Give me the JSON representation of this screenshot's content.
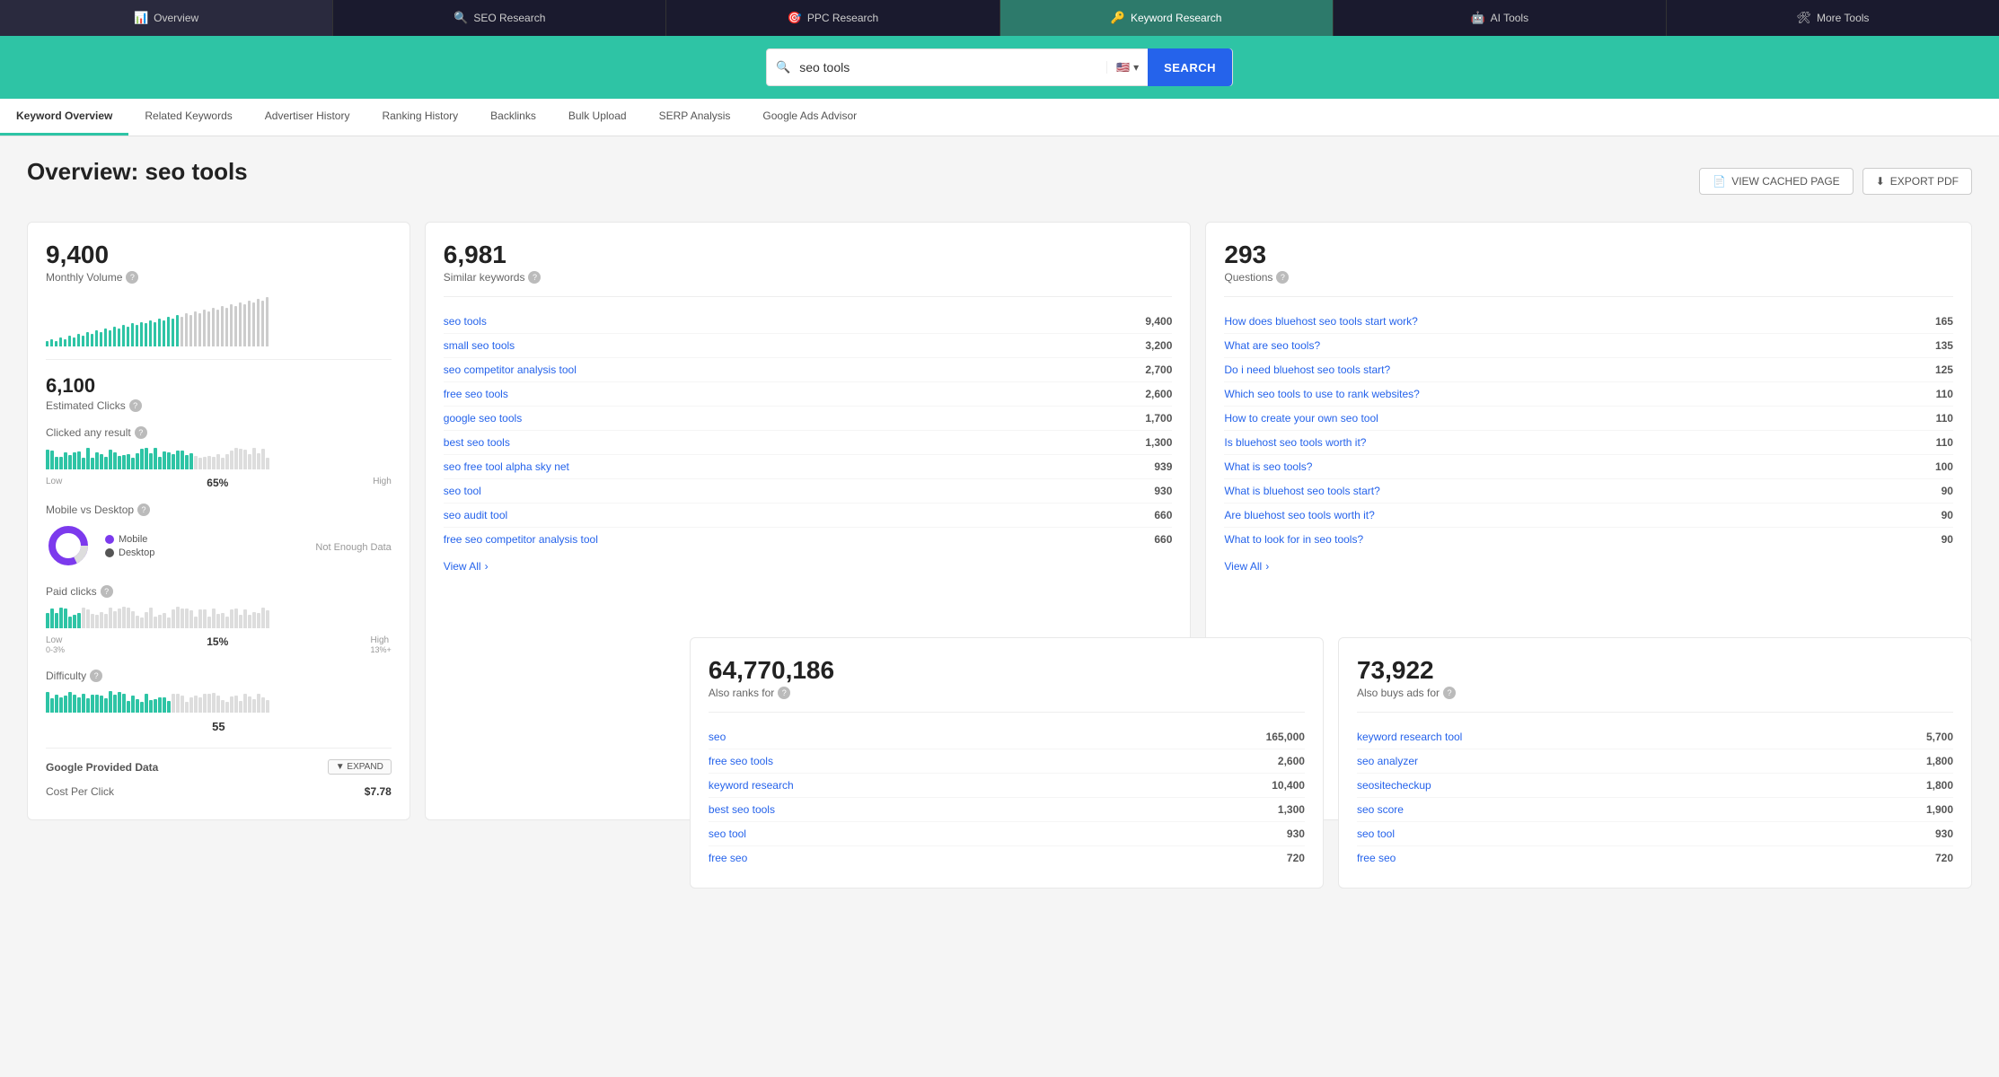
{
  "topNav": {
    "items": [
      {
        "id": "overview",
        "label": "Overview",
        "icon": "📊",
        "active": false
      },
      {
        "id": "seo-research",
        "label": "SEO Research",
        "icon": "🔍",
        "active": false
      },
      {
        "id": "ppc-research",
        "label": "PPC Research",
        "icon": "🎯",
        "active": false
      },
      {
        "id": "keyword-research",
        "label": "Keyword Research",
        "icon": "🔑",
        "active": true
      },
      {
        "id": "ai-tools",
        "label": "AI Tools",
        "icon": "🤖",
        "active": false
      },
      {
        "id": "more-tools",
        "label": "More Tools",
        "icon": "🛠",
        "active": false
      }
    ]
  },
  "search": {
    "query": "seo tools",
    "placeholder": "seo tools",
    "button_label": "SEARCH",
    "flag": "🇺🇸"
  },
  "subNav": {
    "items": [
      {
        "id": "keyword-overview",
        "label": "Keyword Overview",
        "active": true
      },
      {
        "id": "related-keywords",
        "label": "Related Keywords",
        "active": false
      },
      {
        "id": "advertiser-history",
        "label": "Advertiser History",
        "active": false
      },
      {
        "id": "ranking-history",
        "label": "Ranking History",
        "active": false
      },
      {
        "id": "backlinks",
        "label": "Backlinks",
        "active": false
      },
      {
        "id": "bulk-upload",
        "label": "Bulk Upload",
        "active": false
      },
      {
        "id": "serp-analysis",
        "label": "SERP Analysis",
        "active": false
      },
      {
        "id": "google-ads-advisor",
        "label": "Google Ads Advisor",
        "active": false
      }
    ]
  },
  "pageTitle": "Overview: seo tools",
  "actions": {
    "view_cached": "VIEW CACHED PAGE",
    "export_pdf": "EXPORT PDF"
  },
  "leftCard": {
    "monthly_volume": "9,400",
    "monthly_volume_label": "Monthly Volume",
    "estimated_clicks": "6,100",
    "estimated_clicks_label": "Estimated Clicks",
    "clicked_label": "Clicked any result",
    "clicked_pct": "65%",
    "clicked_low": "Low",
    "clicked_high": "High",
    "mobile_vs_desktop_label": "Mobile vs Desktop",
    "mobile_label": "Mobile",
    "desktop_label": "Desktop",
    "not_enough_data": "Not Enough Data",
    "paid_clicks_label": "Paid clicks",
    "paid_pct": "15%",
    "paid_low": "Low",
    "paid_low_range": "0-3%",
    "paid_high": "High",
    "paid_high_range": "13%+",
    "difficulty_label": "Difficulty",
    "difficulty_val": "55",
    "google_provided_label": "Google Provided Data",
    "expand_label": "▼ EXPAND",
    "cost_per_click_label": "Cost Per Click",
    "cost_per_click_val": "$7.78"
  },
  "similarKeywords": {
    "number": "6,981",
    "label": "Similar keywords",
    "rows": [
      {
        "keyword": "seo tools",
        "volume": "9,400"
      },
      {
        "keyword": "small seo tools",
        "volume": "3,200"
      },
      {
        "keyword": "seo competitor analysis tool",
        "volume": "2,700"
      },
      {
        "keyword": "free seo tools",
        "volume": "2,600"
      },
      {
        "keyword": "google seo tools",
        "volume": "1,700"
      },
      {
        "keyword": "best seo tools",
        "volume": "1,300"
      },
      {
        "keyword": "seo free tool alpha sky net",
        "volume": "939"
      },
      {
        "keyword": "seo tool",
        "volume": "930"
      },
      {
        "keyword": "seo audit tool",
        "volume": "660"
      },
      {
        "keyword": "free seo competitor analysis tool",
        "volume": "660"
      }
    ],
    "view_all": "View All"
  },
  "questions": {
    "number": "293",
    "label": "Questions",
    "rows": [
      {
        "question": "How does bluehost seo tools start work?",
        "volume": "165"
      },
      {
        "question": "What are seo tools?",
        "volume": "135"
      },
      {
        "question": "Do i need bluehost seo tools start?",
        "volume": "125"
      },
      {
        "question": "Which seo tools to use to rank websites?",
        "volume": "110"
      },
      {
        "question": "How to create your own seo tool",
        "volume": "110"
      },
      {
        "question": "Is bluehost seo tools worth it?",
        "volume": "110"
      },
      {
        "question": "What is seo tools?",
        "volume": "100"
      },
      {
        "question": "What is bluehost seo tools start?",
        "volume": "90"
      },
      {
        "question": "Are bluehost seo tools worth it?",
        "volume": "90"
      },
      {
        "question": "What to look for in seo tools?",
        "volume": "90"
      }
    ],
    "view_all": "View All"
  },
  "alsoRanksFor": {
    "number": "64,770,186",
    "label": "Also ranks for",
    "rows": [
      {
        "keyword": "seo",
        "volume": "165,000"
      },
      {
        "keyword": "free seo tools",
        "volume": "2,600"
      },
      {
        "keyword": "keyword research",
        "volume": "10,400"
      },
      {
        "keyword": "best seo tools",
        "volume": "1,300"
      },
      {
        "keyword": "seo tool",
        "volume": "930"
      },
      {
        "keyword": "free seo",
        "volume": "720"
      }
    ]
  },
  "alsoBuysAds": {
    "number": "73,922",
    "label": "Also buys ads for",
    "rows": [
      {
        "keyword": "keyword research tool",
        "volume": "5,700"
      },
      {
        "keyword": "seo analyzer",
        "volume": "1,800"
      },
      {
        "keyword": "seositecheckup",
        "volume": "1,800"
      },
      {
        "keyword": "seo score",
        "volume": "1,900"
      },
      {
        "keyword": "seo tool",
        "volume": "930"
      },
      {
        "keyword": "free seo",
        "volume": "720"
      }
    ]
  },
  "miniChart": {
    "bars": [
      3,
      4,
      3,
      5,
      4,
      6,
      5,
      7,
      6,
      8,
      7,
      9,
      8,
      10,
      9,
      11,
      10,
      12,
      11,
      13,
      12,
      14,
      13,
      15,
      14,
      16,
      15,
      17,
      16,
      18,
      17,
      19,
      18,
      20,
      19,
      21,
      20,
      22,
      21,
      23,
      22,
      24,
      23,
      25,
      24,
      26,
      25,
      27,
      26,
      28
    ]
  }
}
